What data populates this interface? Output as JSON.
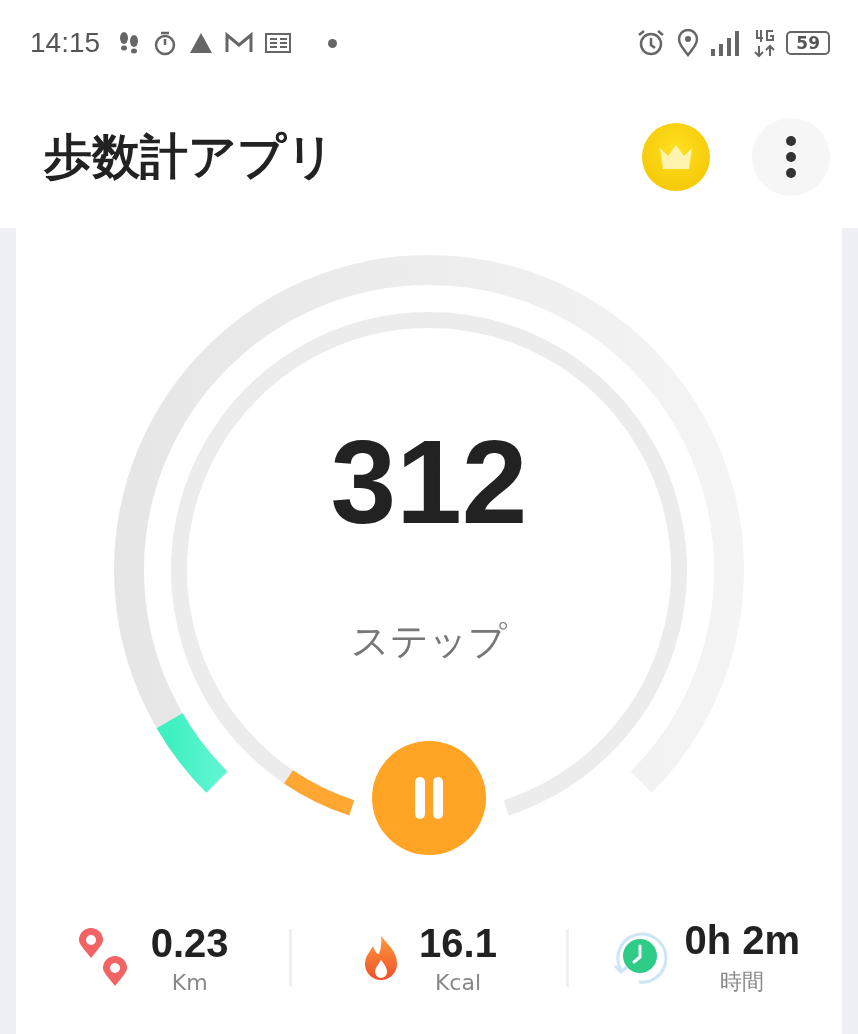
{
  "status_bar": {
    "time": "14:15",
    "battery": "59"
  },
  "app_bar": {
    "title": "歩数計アプリ"
  },
  "tracker": {
    "steps": "312",
    "steps_label": "ステップ"
  },
  "stats": [
    {
      "kind": "distance",
      "value": "0.23",
      "unit": "Km"
    },
    {
      "kind": "calories",
      "value": "16.1",
      "unit": "Kcal"
    },
    {
      "kind": "time",
      "value": "0h 2m",
      "unit": "時間"
    }
  ]
}
